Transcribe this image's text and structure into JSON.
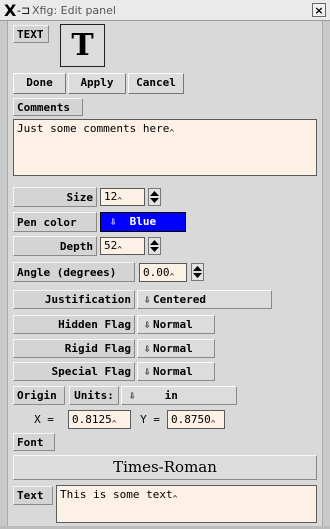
{
  "window": {
    "title": "Xfig: Edit panel",
    "close_glyph": "×"
  },
  "object": {
    "type_label": "TEXT",
    "icon_glyph": "T"
  },
  "actions": {
    "done": "Done",
    "apply": "Apply",
    "cancel": "Cancel"
  },
  "comments": {
    "label": "Comments",
    "value": "Just some comments here"
  },
  "size": {
    "label": "Size",
    "value": "12"
  },
  "pen_color": {
    "label": "Pen color",
    "value": "Blue",
    "swatch_color": "#0000ff"
  },
  "depth": {
    "label": "Depth",
    "value": "52"
  },
  "angle": {
    "label": "Angle (degrees)",
    "value": "0.00"
  },
  "justification": {
    "label": "Justification",
    "value": "Centered"
  },
  "hidden_flag": {
    "label": "Hidden Flag",
    "value": "Normal"
  },
  "rigid_flag": {
    "label": "Rigid Flag",
    "value": "Normal"
  },
  "special_flag": {
    "label": "Special Flag",
    "value": "Normal"
  },
  "origin": {
    "label": "Origin",
    "units_label": "Units:",
    "units_value": "in",
    "x_label": "X =",
    "x_value": "0.8125",
    "y_label": "Y =",
    "y_value": "0.8750"
  },
  "font": {
    "label": "Font",
    "value": "Times-Roman"
  },
  "text": {
    "label": "Text",
    "value": "This is some text"
  },
  "colors": {
    "field_bg": "#fdf0e4",
    "panel_bg": "#d9d9d9",
    "blue_swatch": "#0000ff"
  },
  "icons": {
    "down_arrow": "down-arrow-icon",
    "spinner": "spinner-icon",
    "close": "close-icon"
  }
}
